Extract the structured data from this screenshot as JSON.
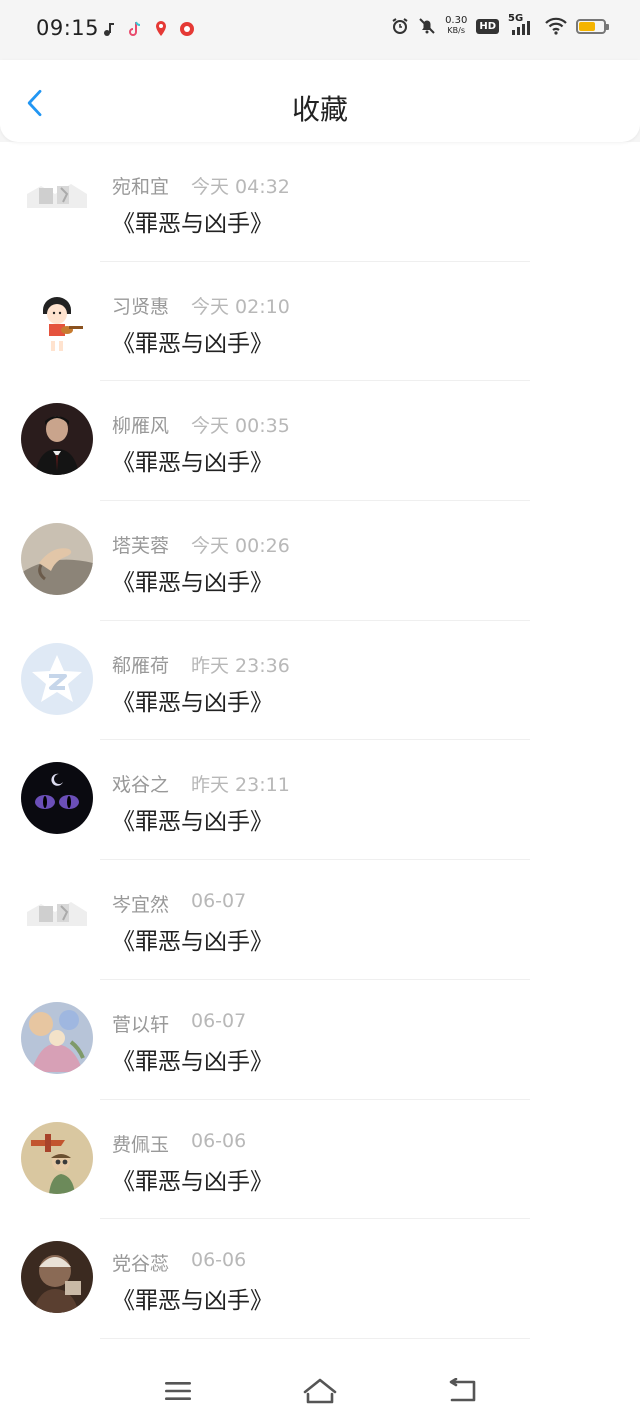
{
  "status_bar": {
    "time": "09:15",
    "net_speed_value": "0.30",
    "net_speed_unit": "KB/s",
    "hd_badge": "HD",
    "network_type": "5G",
    "battery_color": "#f5b400"
  },
  "header": {
    "title": "收藏",
    "back_icon": "chevron-left-icon",
    "accent_color": "#2196f3"
  },
  "favorites": [
    {
      "name": "宛和宜",
      "time": "今天 04:32",
      "title": "《罪恶与凶手》",
      "avatar": "broken-image"
    },
    {
      "name": "习贤惠",
      "time": "今天 02:10",
      "title": "《罪恶与凶手》",
      "avatar": "cartoon-girl"
    },
    {
      "name": "柳雁风",
      "time": "今天 00:35",
      "title": "《罪恶与凶手》",
      "avatar": "dark-portrait"
    },
    {
      "name": "塔芙蓉",
      "time": "今天 00:26",
      "title": "《罪恶与凶手》",
      "avatar": "hand-photo"
    },
    {
      "name": "郗雁荷",
      "time": "昨天 23:36",
      "title": "《罪恶与凶手》",
      "avatar": "qzone-star"
    },
    {
      "name": "戏谷之",
      "time": "昨天 23:11",
      "title": "《罪恶与凶手》",
      "avatar": "cat-eyes"
    },
    {
      "name": "岑宜然",
      "time": "06-07",
      "title": "《罪恶与凶手》",
      "avatar": "broken-image"
    },
    {
      "name": "菅以轩",
      "time": "06-07",
      "title": "《罪恶与凶手》",
      "avatar": "colorful-art"
    },
    {
      "name": "费佩玉",
      "time": "06-06",
      "title": "《罪恶与凶手》",
      "avatar": "toy-plane"
    },
    {
      "name": "党谷蕊",
      "time": "06-06",
      "title": "《罪恶与凶手》",
      "avatar": "sepia-photo"
    }
  ],
  "nav_bar": {
    "menu_icon": "menu-icon",
    "home_icon": "home-icon",
    "back_icon": "back-icon"
  }
}
